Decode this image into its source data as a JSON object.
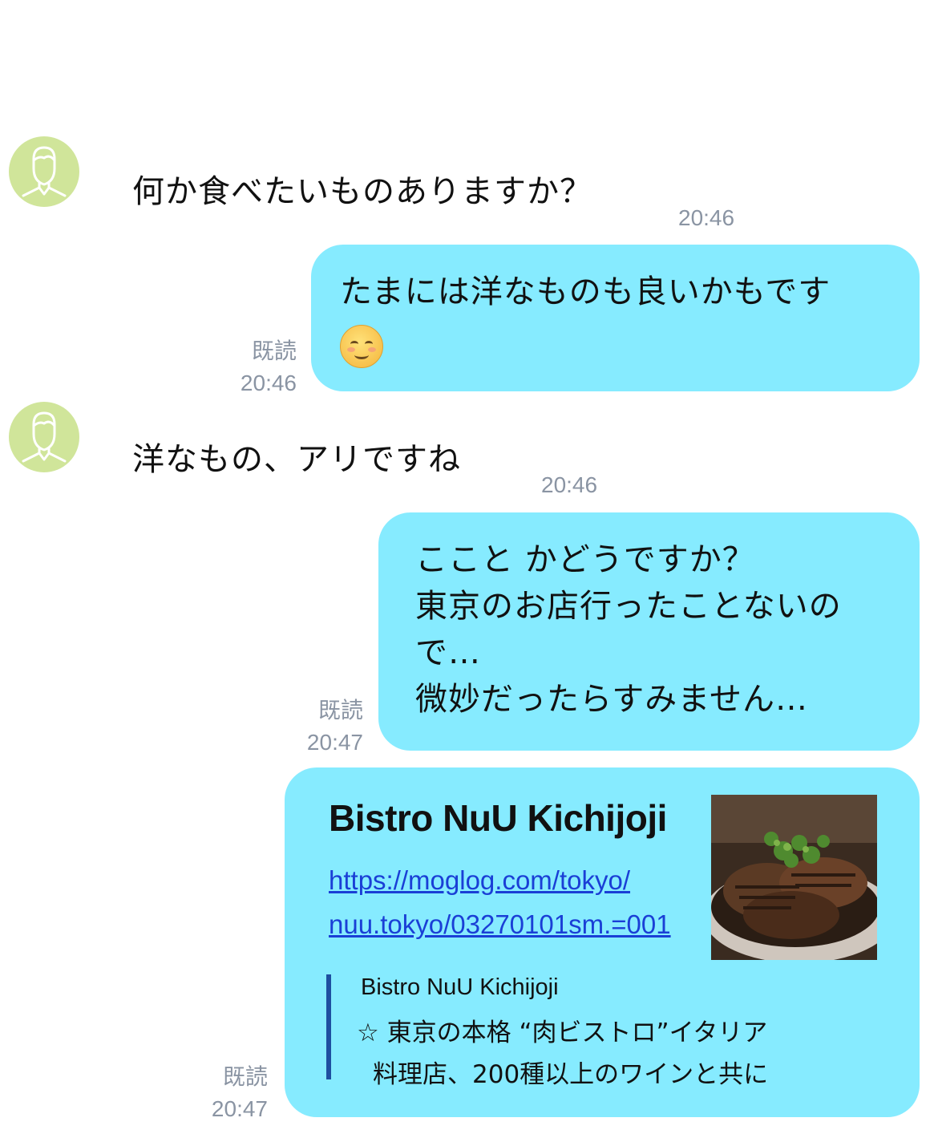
{
  "messages": [
    {
      "from": "contact",
      "text": "何か食べたいものありますか？",
      "time": "20:46"
    },
    {
      "from": "me",
      "text": "たまには洋なものも良いかもです",
      "emoji": "smiling-face-emoji",
      "read": "既読",
      "time": "20:46"
    },
    {
      "from": "contact",
      "text": "洋なもの、アリですね",
      "time": "20:46"
    },
    {
      "from": "me",
      "lines": [
        "ここと かどうですか？",
        "東京のお店行ったことないの",
        "で…",
        "微妙だったらすみません…"
      ],
      "read": "既読",
      "time": "20:47"
    },
    {
      "from": "me",
      "link_card": {
        "title": "Bistro NuU Kichijoji",
        "url_line1": "https://moglog.com/tokyo/",
        "url_line2": "nuu.tokyo/03270101sm.=001",
        "preview_title": "Bistro NuU Kichijoji",
        "preview_desc_line1": "☆ 東京の本格 “肉ビストロ”イタリア",
        "preview_desc_line2": "料理店、200種以上のワインと共に"
      },
      "read": "既読",
      "time": "20:47"
    }
  ],
  "icons": {
    "avatar": "person-avatar-icon",
    "link_image": "grilled-meat-photo"
  },
  "colors": {
    "bubble": "#86ebff",
    "avatar_bg": "#d0e59a",
    "meta": "#8a94a3",
    "link": "#1a3fd6",
    "quote_bar": "#1e4fa0"
  }
}
